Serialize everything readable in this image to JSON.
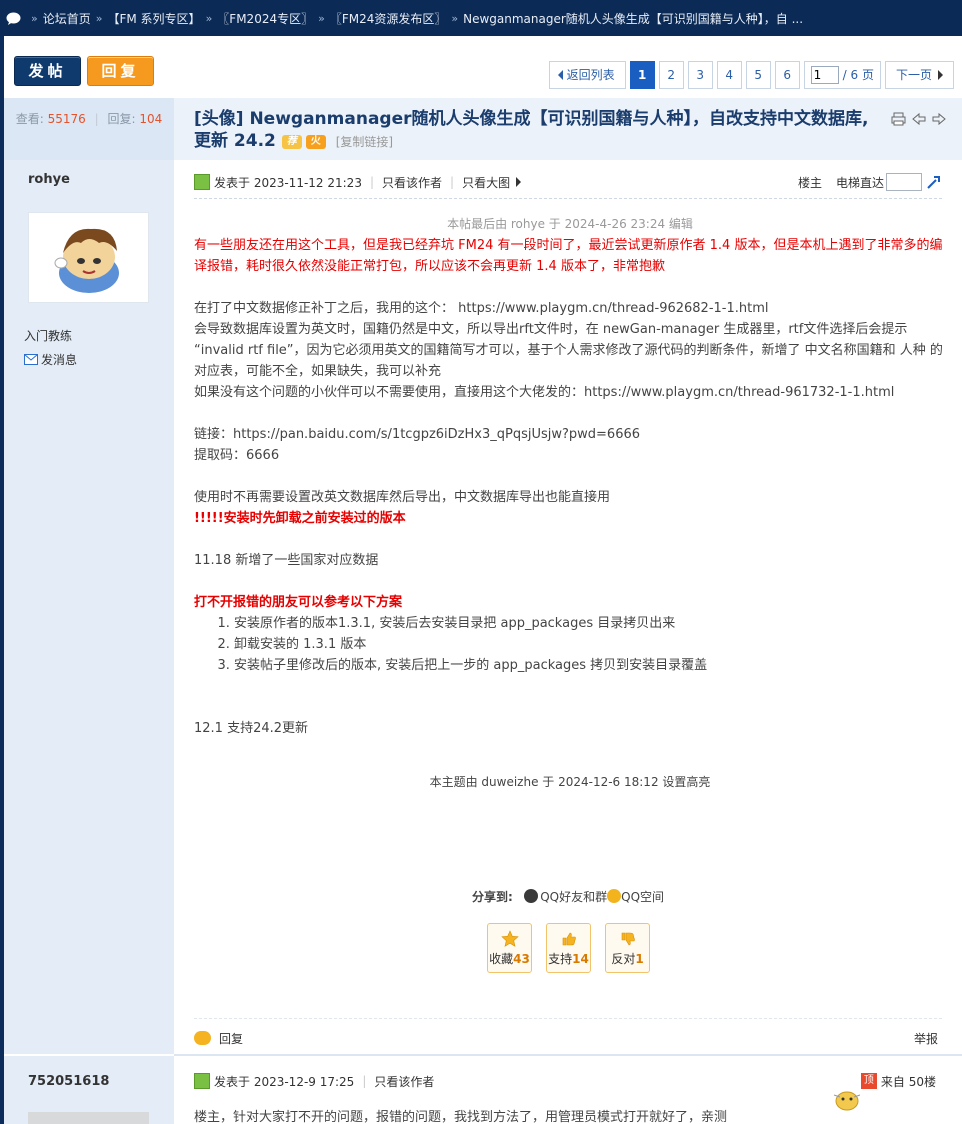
{
  "breadcrumb": {
    "items": [
      "论坛首页",
      "【FM 系列专区】",
      "〖FM2024专区〗",
      "〖FM24资源发布区〗",
      "Newganmanager随机人头像生成【可识别国籍与人种】，自 ..."
    ],
    "separator": "»"
  },
  "toolbar": {
    "post_label": "发帖",
    "reply_label": "回复"
  },
  "pager": {
    "back_label": "返回列表",
    "pages": [
      "1",
      "2",
      "3",
      "4",
      "5",
      "6"
    ],
    "current": "1",
    "jump_value": "1",
    "total_label": "/ 6 页",
    "next_label": "下一页"
  },
  "thread": {
    "stats_views_label": "查看:",
    "stats_views": "55176",
    "stats_replies_label": "回复:",
    "stats_replies": "104",
    "title": "[头像] Newganmanager随机人头像生成【可识别国籍与人种】，自改支持中文数据库, 更新 24.2",
    "tag_recommend": "荐",
    "tag_hot": "火",
    "copy_link": "[复制链接]"
  },
  "post1": {
    "author": "rohye",
    "rank": "入门教练",
    "pm_label": "发消息",
    "posted_at": "发表于 2023-11-12 21:23",
    "only_author": "只看该作者",
    "large_image": "只看大图",
    "floor_label": "楼主",
    "elevator_label": "电梯直达",
    "edit_note": "本帖最后由 rohye 于 2024-4-26 23:24 编辑",
    "p1": "有一些朋友还在用这个工具，但是我已经弃坑 FM24 有一段时间了，最近尝试更新原作者 1.4 版本，但是本机上遇到了非常多的编译报错，耗时很久依然没能正常打包，所以应该不会再更新 1.4 版本了，非常抱歉",
    "p2": "在打了中文数据修正补丁之后，我用的这个： https://www.playgm.cn/thread-962682-1-1.html",
    "p3": "会导致数据库设置为英文时，国籍仍然是中文，所以导出rft文件时，在 newGan-manager 生成器里，rtf文件选择后会提示 “invalid rtf file”，因为它必须用英文的国籍简写才可以，基于个人需求修改了源代码的判断条件，新增了 中文名称国籍和 人种 的对应表，可能不全，如果缺失，我可以补充",
    "p4": "如果没有这个问题的小伙伴可以不需要使用，直接用这个大佬发的：https://www.playgm.cn/thread-961732-1-1.html",
    "link": "链接：https://pan.baidu.com/s/1tcgpz6iDzHx3_qPqsjUsjw?pwd=6666",
    "code": "提取码：6666",
    "p5": "使用时不再需要设置改英文数据库然后导出，中文数据库导出也能直接用",
    "warn": "!!!!!安装时先卸载之前安装过的版本",
    "update1": "11.18 新增了一些国家对应数据",
    "fix_title": "打不开报错的朋友可以参考以下方案",
    "steps": [
      "安装原作者的版本1.3.1, 安装后去安装目录把 app_packages 目录拷贝出来",
      "卸载安装的 1.3.1 版本",
      "安装帖子里修改后的版本, 安装后把上一步的 app_packages 拷贝到安装目录覆盖"
    ],
    "update2": "12.1 支持24.2更新",
    "mod_note": "本主题由 duweizhe 于 2024-12-6 18:12 设置高亮",
    "share_label": "分享到:",
    "share_qq": "QQ好友和群",
    "share_qzone": "QQ空间",
    "fav_label": "收藏",
    "fav_count": "43",
    "support_label": "支持",
    "support_count": "14",
    "oppose_label": "反对",
    "oppose_count": "1",
    "reply_label": "回复",
    "report_label": "举报"
  },
  "post2": {
    "author": "752051618",
    "posted_at": "发表于 2023-12-9 17:25",
    "only_author": "只看该作者",
    "floor_badge": "顶",
    "floor_label": "来自 50楼",
    "text": "楼主，针对大家打不开的问题，报错的问题，我找到方法了，用管理员模式打开就好了，亲测"
  },
  "colors": {
    "topbar_bg": "#0b2a56",
    "accent_blue": "#1b5ec2",
    "reply_orange": "#f59a1f",
    "warning_red": "#e60000",
    "sidebar_bg": "#e4edf7"
  }
}
